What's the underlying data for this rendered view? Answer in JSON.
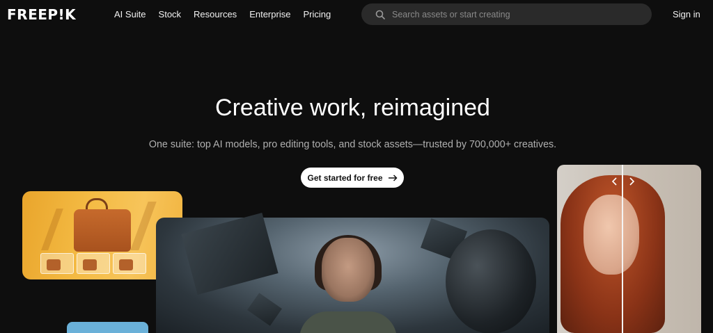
{
  "header": {
    "logo": "FREEP!K",
    "nav": [
      {
        "label": "AI Suite"
      },
      {
        "label": "Stock"
      },
      {
        "label": "Resources"
      },
      {
        "label": "Enterprise"
      },
      {
        "label": "Pricing"
      }
    ],
    "search_placeholder": "Search assets or start creating",
    "signin": "Sign in"
  },
  "hero": {
    "title": "Creative work, reimagined",
    "subtitle": "One suite: top AI models, pro editing tools, and stock assets—trusted by 700,000+ creatives.",
    "cta_label": "Get started for free"
  },
  "icons": {
    "search": "search-icon",
    "cta_arrow": "arrow-right-icon",
    "compare_left": "chevron-left-icon",
    "compare_right": "chevron-right-icon"
  },
  "colors": {
    "background": "#0e0e0e",
    "search_bg": "#2a2a2a",
    "cta_bg": "#ffffff",
    "text": "#ffffff",
    "muted": "#b0b0b0"
  }
}
